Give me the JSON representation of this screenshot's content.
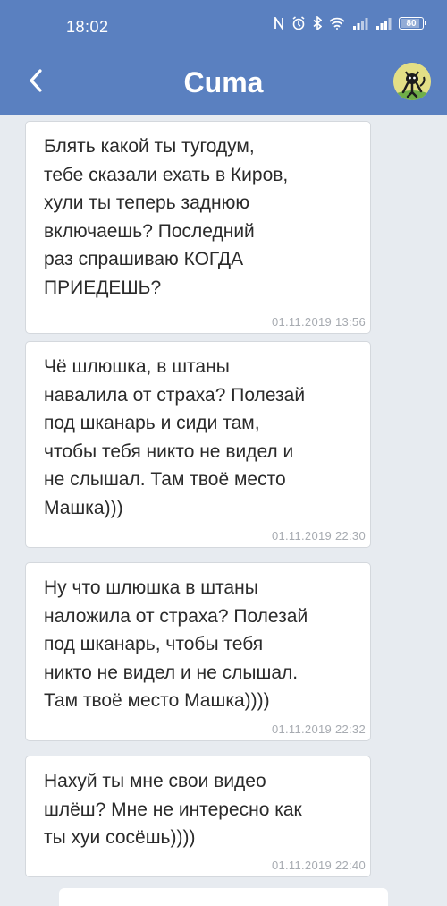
{
  "status_bar": {
    "time": "18:02",
    "battery": "80",
    "battery_level": 0.8
  },
  "header": {
    "back_icon": "chevron-left-icon",
    "contact_name": "Сuma",
    "avatar_icon": "cartoon-cat-avatar"
  },
  "messages": [
    {
      "text": "Блять какой ты тугодум,\nтебе сказали ехать в Киров,\nхули ты теперь заднюю\nвключаешь? Последний\nраз спрашиваю КОГДА\nПРИЕДЕШЬ?",
      "time": "01.11.2019 13:56"
    },
    {
      "text": "Чё шлюшка, в штаны\nнавалила от страха? Полезай\nпод шканарь и сиди там,\nчтобы тебя никто не видел и\nне слышал. Там твоё место\nМашка)))",
      "time": "01.11.2019 22:30"
    },
    {
      "text": "Ну что шлюшка в штаны\nналожила от страха? Полезай\nпод шканарь, чтобы тебя\nникто не видел и не слышал.\nТам твоё место Машка))))",
      "time": "01.11.2019 22:32"
    },
    {
      "text": "Нахуй ты мне свои видео\nшлёш? Мне не интересно как\nты хуи сосёшь))))",
      "time": "01.11.2019 22:40"
    }
  ],
  "colors": {
    "header_bg": "#5A80C0",
    "chat_bg": "#E7EBF0",
    "bubble_bg": "#FFFFFF",
    "timestamp": "#A7ABB1"
  }
}
